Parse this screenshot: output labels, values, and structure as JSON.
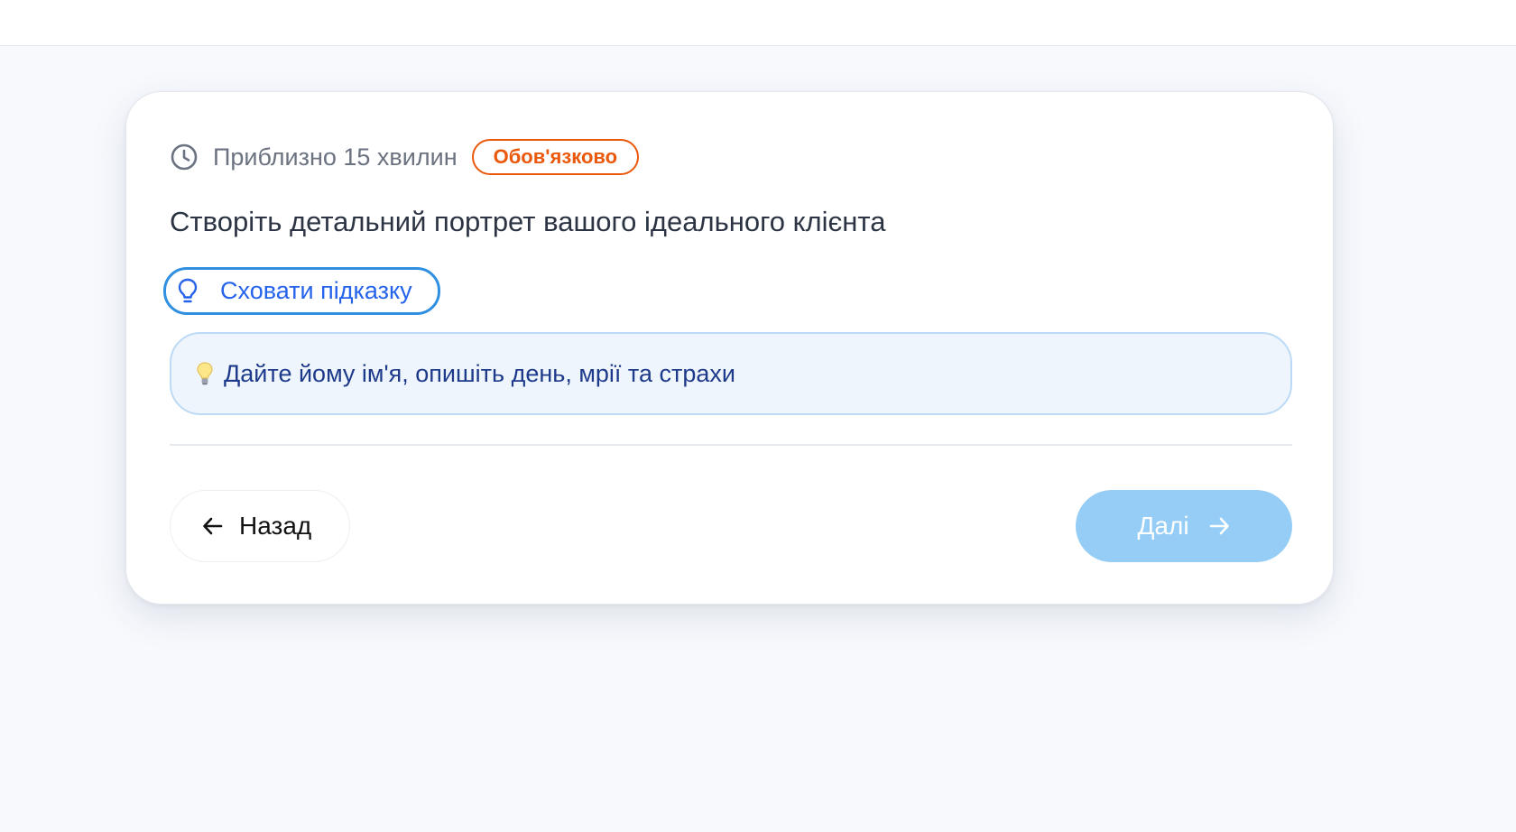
{
  "question_card": {
    "estimated_time": "Приблизно 15 хвилин",
    "required_badge": "Обов'язково",
    "question_text": "Створіть детальний портрет вашого ідеального клієнта",
    "hint_toggle_label": "Сховати підказку",
    "hint_text": "Дайте йому ім'я, опишіть день, мрії та страхи",
    "icons": {
      "time": "clock-icon",
      "hint_toggle": "lightbulb-icon",
      "hint": "lightbulb-emoji-icon",
      "back": "arrow-left-icon",
      "next": "arrow-right-icon"
    }
  },
  "navigation": {
    "back_label": "Назад",
    "next_label": "Далі",
    "next_disabled": true
  },
  "colors": {
    "badge": "#ea580c",
    "hint_toggle_border": "#2f8fe0",
    "hint_toggle_text": "#2563eb",
    "hint_box_bg": "#eef5fd",
    "hint_text": "#1e3a8a",
    "next_button_bg": "#96cdf6"
  }
}
